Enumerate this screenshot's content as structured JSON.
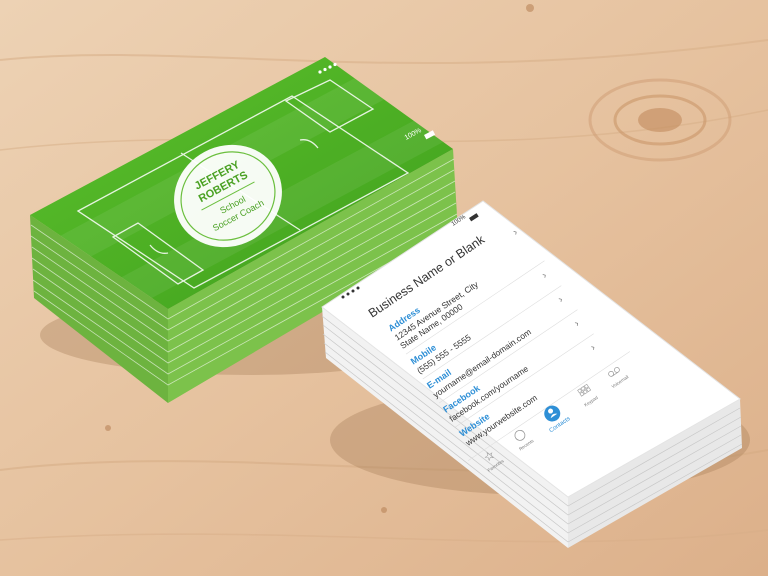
{
  "colors": {
    "wood": "#e7c6a4",
    "field_green": "#4fb426",
    "accent_blue": "#2e8fd6",
    "card_white": "#ffffff"
  },
  "green_card": {
    "status_battery": "100%",
    "name_line1": "JEFFERY",
    "name_line2": "ROBERTS",
    "role_line1": "School",
    "role_line2": "Soccer Coach"
  },
  "white_card": {
    "status_battery": "100%",
    "title": "Business Name or Blank",
    "fields": [
      {
        "label": "Address",
        "value_line1": "12345 Avenue Street, City",
        "value_line2": "State Name, 00000"
      },
      {
        "label": "Mobile",
        "value_line1": "(555) 555 - 5555",
        "value_line2": ""
      },
      {
        "label": "E-mail",
        "value_line1": "yourname@email-domain.com",
        "value_line2": ""
      },
      {
        "label": "Facebook",
        "value_line1": "facebook.com/yourname",
        "value_line2": ""
      },
      {
        "label": "Website",
        "value_line1": "www.yourwebsite.com",
        "value_line2": ""
      }
    ],
    "tabbar": [
      {
        "label": "Favorites",
        "icon": "star-icon",
        "active": false
      },
      {
        "label": "Recents",
        "icon": "clock-icon",
        "active": false
      },
      {
        "label": "Contacts",
        "icon": "contact-person-icon",
        "active": true
      },
      {
        "label": "Keypad",
        "icon": "keypad-grid-icon",
        "active": false
      },
      {
        "label": "Voicemail",
        "icon": "voicemail-icon",
        "active": false
      }
    ]
  }
}
